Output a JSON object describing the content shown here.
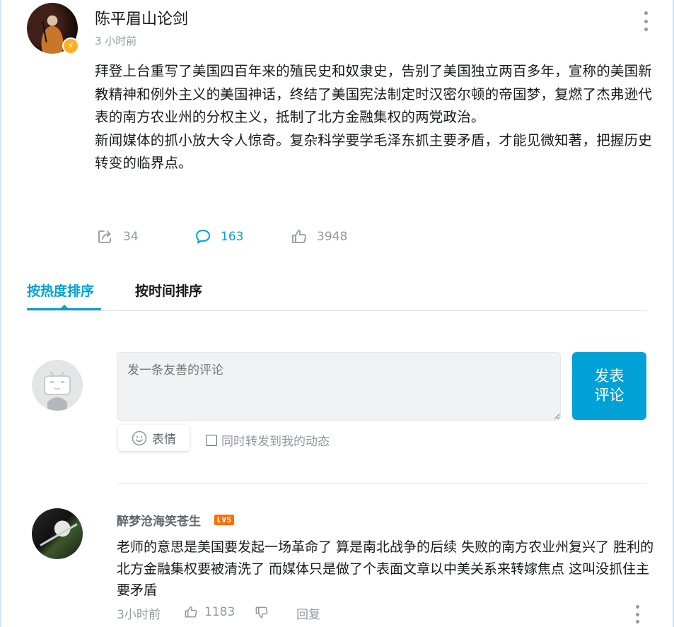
{
  "post": {
    "author": "陈平眉山论剑",
    "time": "3 小时前",
    "paragraphs": [
      "拜登上台重写了美国四百年来的殖民史和奴隶史，告别了美国独立两百多年，宣称的美国新教精神和例外主义的美国神话，终结了美国宪法制定时汉密尔顿的帝国梦，复燃了杰弗逊代表的南方农业州的分权主义，抵制了北方金融集权的两党政治。",
      "新闻媒体的抓小放大令人惊奇。复杂科学要学毛泽东抓主要矛盾，才能见微知著，把握历史转变的临界点。"
    ],
    "share_count": "34",
    "comment_count": "163",
    "like_count": "3948"
  },
  "tabs": {
    "hot": "按热度排序",
    "time": "按时间排序"
  },
  "composer": {
    "placeholder": "发一条友善的评论",
    "submit": "发表评论",
    "emoji": "表情",
    "repost": "同时转发到我的动态"
  },
  "reply": {
    "username": "醉梦沧海笑苍生",
    "level": "LV5",
    "text": "老师的意思是美国要发起一场革命了 算是南北战争的后续 失败的南方农业州复兴了  胜利的北方金融集权要被清洗了 而媒体只是做了个表面文章以中美关系来转嫁焦点  这叫没抓住主要矛盾",
    "time": "3小时前",
    "likes": "1183",
    "reply_label": "回复"
  },
  "colors": {
    "accent": "#00a1d6",
    "muted": "#9499a0",
    "level_badge": "#ff6c00",
    "verify": "#ffb027"
  },
  "icons": [
    "share-icon",
    "comment-icon",
    "like-icon",
    "dislike-icon",
    "more-vertical-icon",
    "emoji-icon",
    "verify-badge-icon"
  ]
}
